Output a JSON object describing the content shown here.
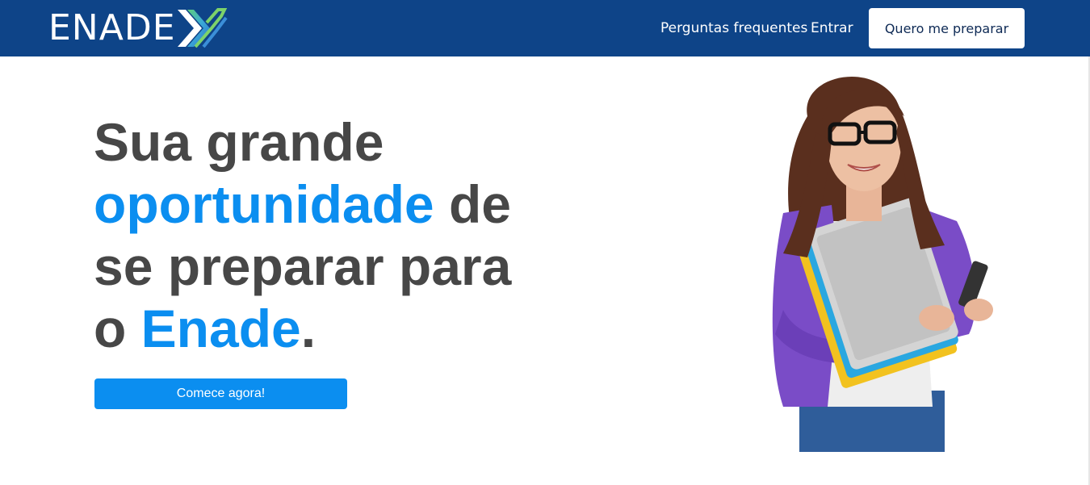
{
  "header": {
    "logo_text": "ENADE",
    "logo_letter": "X",
    "nav": {
      "faq": "Perguntas frequentes",
      "login": "Entrar",
      "cta": "Quero me preparar"
    }
  },
  "hero": {
    "line1": "Sua grande",
    "highlight1": "oportunidade",
    "line2_rest": " de",
    "line3": "se preparar para",
    "line4_prefix": "o ",
    "highlight2": "Enade",
    "line4_suffix": ".",
    "button": "Comece agora!"
  },
  "colors": {
    "navbar": "#0e4488",
    "accent": "#0b8ef0",
    "headline": "#474747"
  },
  "icons": {
    "logo": "enadex-logo",
    "hero": "student-with-notebooks-photo"
  }
}
